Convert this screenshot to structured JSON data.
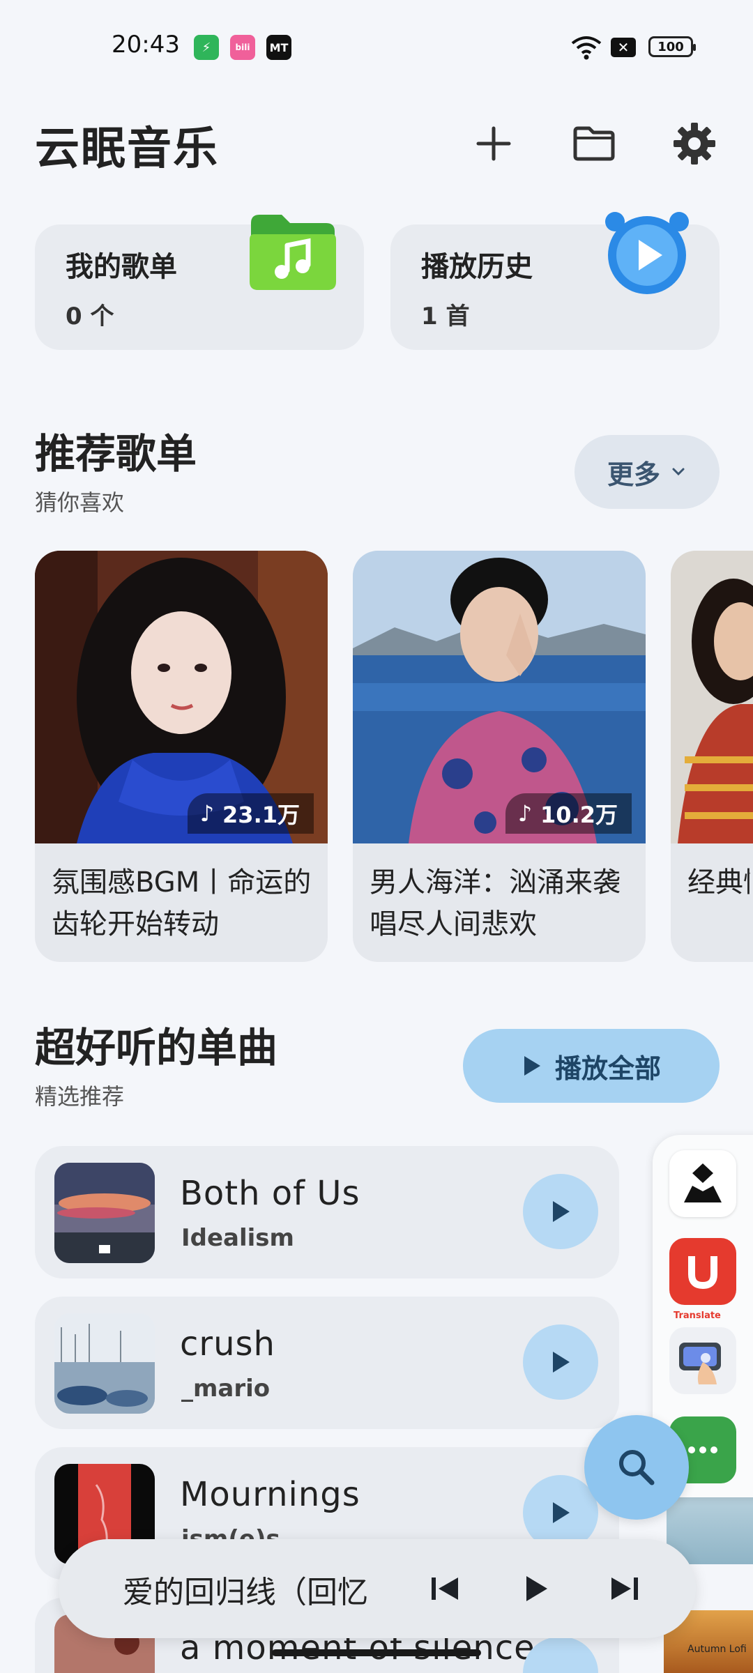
{
  "status": {
    "time": "20:43",
    "battery": "100",
    "colors": {
      "shield": "#2fb55a",
      "bili": "#f0609a",
      "mt": "#111111"
    }
  },
  "header": {
    "title": "云眠音乐"
  },
  "quick_cards": [
    {
      "title": "我的歌单",
      "count": "0 个",
      "icon": "music-folder-icon"
    },
    {
      "title": "播放历史",
      "count": "1 首",
      "icon": "alarm-clock-icon"
    }
  ],
  "recommend": {
    "title": "推荐歌单",
    "subtitle": "猜你喜欢",
    "more_label": "更多",
    "playlists": [
      {
        "name": "氛围感BGM丨命运的齿轮开始转动",
        "plays": "23.1万"
      },
      {
        "name": "男人海洋：汹涌来袭唱尽人间悲欢",
        "plays": "10.2万"
      },
      {
        "name": "经典情歌集忆往"
      }
    ]
  },
  "singles": {
    "title": "超好听的单曲",
    "subtitle": "精选推荐",
    "play_all_label": "播放全部",
    "songs": [
      {
        "title": "Both of Us",
        "artist": "Idealism"
      },
      {
        "title": "crush",
        "artist": "_mario"
      },
      {
        "title": "Mournings",
        "artist": "ism(e)s"
      },
      {
        "title": "a moment of silence",
        "artist": ""
      }
    ]
  },
  "dock": {
    "apps": [
      "dark-app-icon",
      "translate-app-icon",
      "touch-app-icon",
      "more-app-icon"
    ],
    "translate_label": "Translate",
    "autumn_label": "Autumn Lofi"
  },
  "player": {
    "now_playing": "爱的回归线（回忆"
  },
  "colors": {
    "accent": "#a6d2f2",
    "accent_dark": "#1e4566"
  }
}
